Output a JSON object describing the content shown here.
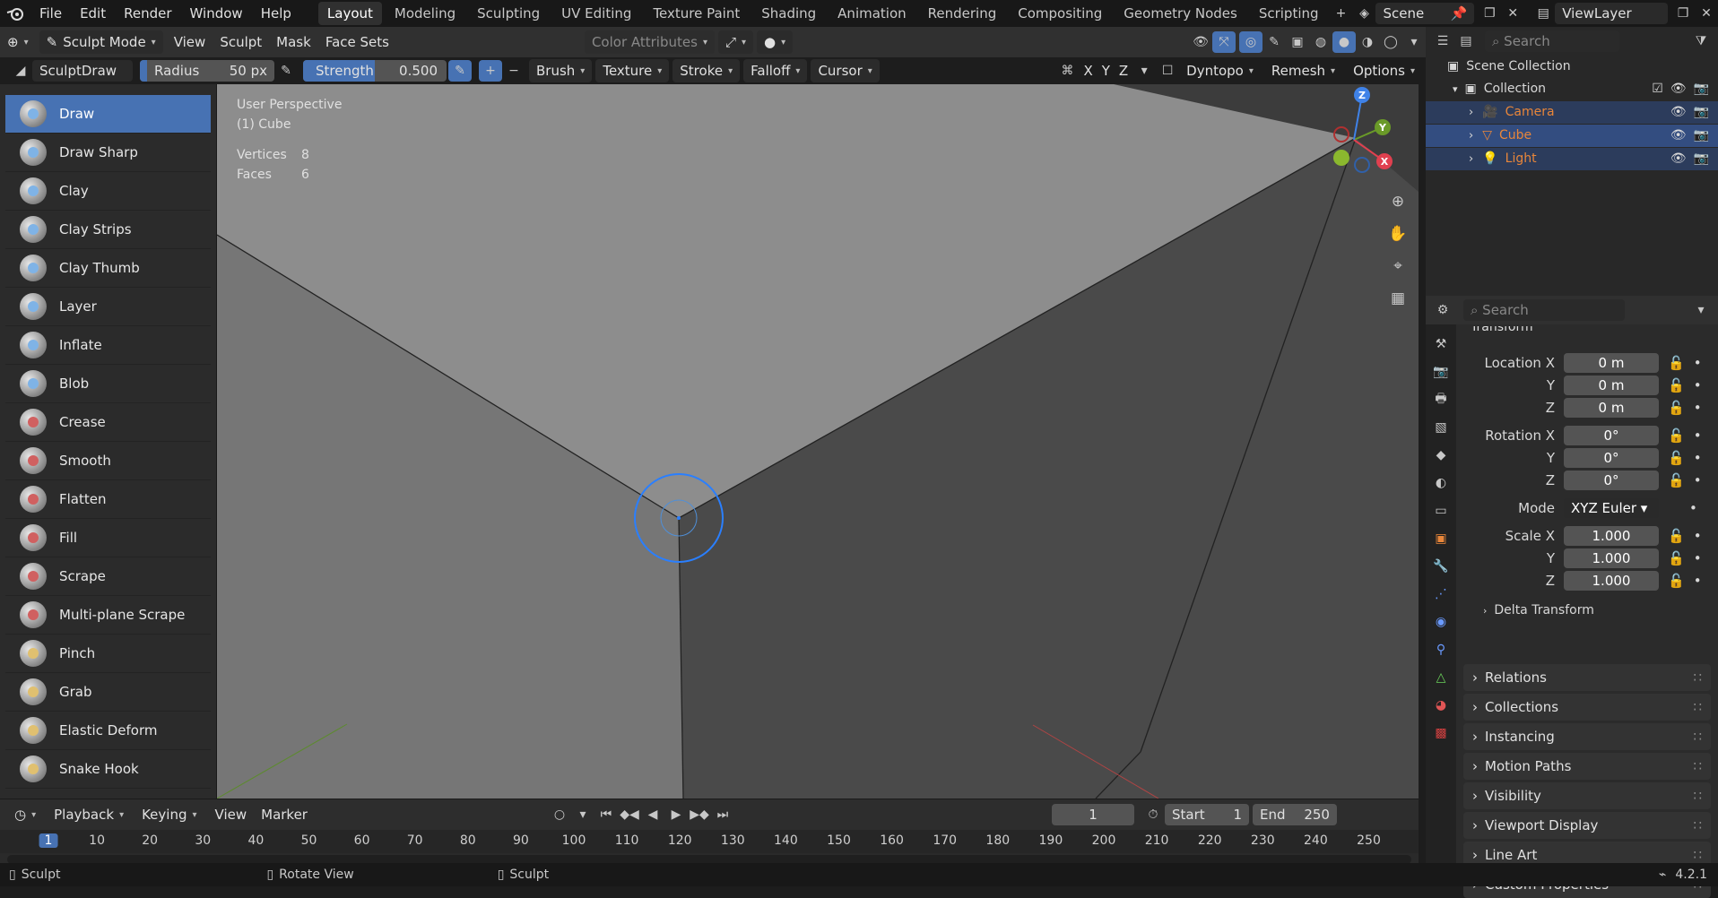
{
  "app": {
    "menu": [
      "File",
      "Edit",
      "Render",
      "Window",
      "Help"
    ],
    "workspaces": [
      "Layout",
      "Modeling",
      "Sculpting",
      "UV Editing",
      "Texture Paint",
      "Shading",
      "Animation",
      "Rendering",
      "Compositing",
      "Geometry Nodes",
      "Scripting"
    ],
    "active_workspace": "Layout",
    "scene": "Scene",
    "view_layer": "ViewLayer"
  },
  "header": {
    "mode": "Sculpt Mode",
    "menus": [
      "View",
      "Sculpt",
      "Mask",
      "Face Sets"
    ],
    "color_attributes": "Color Attributes",
    "axes": [
      "X",
      "Y",
      "Z"
    ]
  },
  "tool_header": {
    "brush_name": "SculptDraw",
    "radius_label": "Radius",
    "radius_value": "50 px",
    "strength_label": "Strength",
    "strength_value": "0.500",
    "strength_fill": 0.5,
    "dropdowns": [
      "Brush",
      "Texture",
      "Stroke",
      "Falloff",
      "Cursor"
    ],
    "dyntopo": "Dyntopo",
    "remesh": "Remesh",
    "options": "Options"
  },
  "tools": [
    {
      "label": "Draw",
      "active": true,
      "icon": "draw-brush-icon",
      "color": "#7fb3e6"
    },
    {
      "label": "Draw Sharp",
      "active": false,
      "icon": "draw-sharp-brush-icon",
      "color": "#7fb3e6"
    },
    {
      "label": "Clay",
      "active": false,
      "icon": "clay-brush-icon",
      "color": "#7fb3e6"
    },
    {
      "label": "Clay Strips",
      "active": false,
      "icon": "clay-strips-brush-icon",
      "color": "#7fb3e6"
    },
    {
      "label": "Clay Thumb",
      "active": false,
      "icon": "clay-thumb-brush-icon",
      "color": "#7fb3e6"
    },
    {
      "label": "Layer",
      "active": false,
      "icon": "layer-brush-icon",
      "color": "#7fb3e6"
    },
    {
      "label": "Inflate",
      "active": false,
      "icon": "inflate-brush-icon",
      "color": "#7fb3e6"
    },
    {
      "label": "Blob",
      "active": false,
      "icon": "blob-brush-icon",
      "color": "#7fb3e6"
    },
    {
      "label": "Crease",
      "active": false,
      "icon": "crease-brush-icon",
      "color": "#d06060"
    },
    {
      "label": "Smooth",
      "active": false,
      "icon": "smooth-brush-icon",
      "color": "#d06060"
    },
    {
      "label": "Flatten",
      "active": false,
      "icon": "flatten-brush-icon",
      "color": "#d06060"
    },
    {
      "label": "Fill",
      "active": false,
      "icon": "fill-brush-icon",
      "color": "#d06060"
    },
    {
      "label": "Scrape",
      "active": false,
      "icon": "scrape-brush-icon",
      "color": "#d06060"
    },
    {
      "label": "Multi-plane Scrape",
      "active": false,
      "icon": "multiplane-scrape-brush-icon",
      "color": "#d06060"
    },
    {
      "label": "Pinch",
      "active": false,
      "icon": "pinch-brush-icon",
      "color": "#e0c070"
    },
    {
      "label": "Grab",
      "active": false,
      "icon": "grab-brush-icon",
      "color": "#e0c070"
    },
    {
      "label": "Elastic Deform",
      "active": false,
      "icon": "elastic-deform-brush-icon",
      "color": "#e0c070"
    },
    {
      "label": "Snake Hook",
      "active": false,
      "icon": "snake-hook-brush-icon",
      "color": "#e0c070"
    }
  ],
  "viewport": {
    "perspective": "User Perspective",
    "object": "(1) Cube",
    "stats": [
      {
        "label": "Vertices",
        "value": "8"
      },
      {
        "label": "Faces",
        "value": "6"
      }
    ],
    "gizmo": {
      "x": "X",
      "y": "Y",
      "z": "Z"
    }
  },
  "outliner": {
    "search_placeholder": "Search",
    "scene_collection": "Scene Collection",
    "collection": "Collection",
    "items": [
      {
        "label": "Camera",
        "icon": "camera-icon",
        "color": "#e8863a"
      },
      {
        "label": "Cube",
        "icon": "mesh-icon",
        "color": "#e8863a"
      },
      {
        "label": "Light",
        "icon": "light-icon",
        "color": "#e8863a"
      }
    ]
  },
  "properties": {
    "search_placeholder": "Search",
    "section": "Transform",
    "location": {
      "label": "Location X",
      "x": "0 m",
      "y": "0 m",
      "z": "0 m"
    },
    "rotation": {
      "label": "Rotation X",
      "x": "0°",
      "y": "0°",
      "z": "0°"
    },
    "mode_label": "Mode",
    "mode_value": "XYZ Euler",
    "scale": {
      "label": "Scale X",
      "x": "1.000",
      "y": "1.000",
      "z": "1.000"
    },
    "axis_y": "Y",
    "axis_z": "Z",
    "delta_transform": "Delta Transform",
    "panels": [
      "Relations",
      "Collections",
      "Instancing",
      "Motion Paths",
      "Visibility",
      "Viewport Display",
      "Line Art",
      "Custom Properties"
    ]
  },
  "timeline": {
    "menus": [
      "Playback",
      "Keying",
      "View",
      "Marker"
    ],
    "current_frame": "1",
    "start_label": "Start",
    "start_value": "1",
    "end_label": "End",
    "end_value": "250",
    "ticks": [
      "1",
      "10",
      "20",
      "30",
      "40",
      "50",
      "60",
      "70",
      "80",
      "90",
      "100",
      "110",
      "120",
      "130",
      "140",
      "150",
      "160",
      "170",
      "180",
      "190",
      "200",
      "210",
      "220",
      "230",
      "240",
      "250"
    ]
  },
  "statusbar": {
    "left": "Sculpt",
    "middle": "Rotate View",
    "right": "Sculpt",
    "version": "4.2.1"
  }
}
